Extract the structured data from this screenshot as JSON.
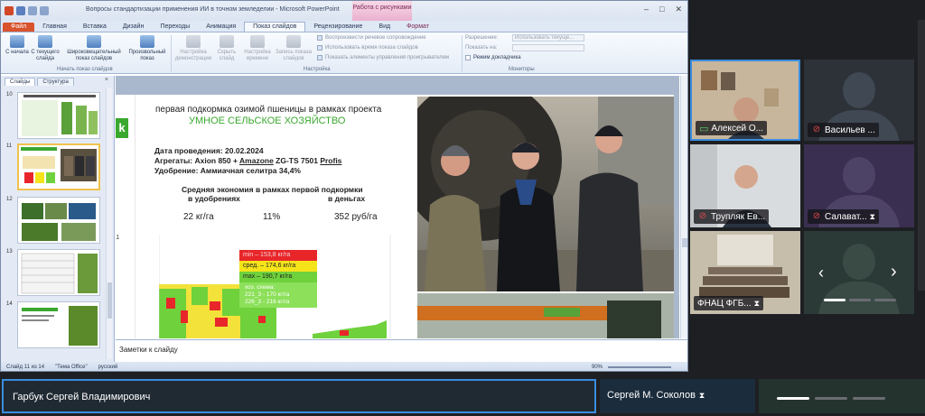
{
  "window": {
    "title": "Вопросы стандартизации применения ИИ в точном земледелии - Microsoft PowerPoint",
    "context_tool": "Работа с рисунками"
  },
  "tabs": [
    "Файл",
    "Главная",
    "Вставка",
    "Дизайн",
    "Переходы",
    "Анимация",
    "Показ слайдов",
    "Рецензирование",
    "Вид",
    "Формат"
  ],
  "ribbon": {
    "buttons": {
      "from_start": "С начала",
      "from_current": "С текущего слайда",
      "broadcast": "Широковещательный показ слайдов",
      "custom": "Произвольный показ",
      "setup": "Настройка демонстрации",
      "hide": "Скрыть слайд",
      "rehearse": "Настройка времени",
      "record": "Запись показа слайдов"
    },
    "groups": {
      "start": "Начать показ слайдов",
      "setup": "Настройка",
      "monitors": "Мониторы"
    },
    "checks": {
      "narration": "Воспроизвести речевое сопровождение",
      "timings": "Использовать время показа слайдов",
      "controls": "Показать элементы управления проигрывателем"
    },
    "monitors": {
      "resolution_label": "Разрешение:",
      "resolution_value": "Использовать текуще...",
      "show_on": "Показать на:",
      "presenter": "Режим докладчика"
    }
  },
  "pane": {
    "tabs": [
      "Слайды",
      "Структура"
    ],
    "close": "×",
    "slide_numbers": [
      "10",
      "11",
      "12",
      "13",
      "14"
    ]
  },
  "slide": {
    "heading1": "первая подкормка озимой пшеницы  в рамках проекта",
    "heading2": "УМНОЕ СЕЛЬСКОЕ ХОЗЯЙСТВО",
    "date": "Дата проведения: 20.02.2024",
    "machines_prefix": "Агрегаты: Axion 850 + ",
    "machines_brand": "Amazone",
    "machines_mid": " ZG-TS 7501 ",
    "machines_end": "Profis",
    "fertilizer": "Удобрение: Аммиачная селитра 34,4%",
    "economy_title": "Средняя экономия в рамках первой подкормки",
    "in_fert": "в удобрениях",
    "in_money": "в деньгах",
    "v_kg": "22 кг/га",
    "v_pct": "11%",
    "v_rub": "352 руб/га",
    "legend_min": "min – 153,8 кг/га",
    "legend_mid": "сред. – 174,6 кг/га",
    "legend_max": "max – 190,7 кг/га",
    "scheme_title": "хоз. схема:",
    "scheme_1": "221_3 - 170 кг/га",
    "scheme_2": "226_3 - 216 кг/га",
    "side_number": "11",
    "logo_fragment": "k"
  },
  "notes": "Заметки к слайду",
  "status": {
    "slide": "Слайд 11 из 14",
    "theme": "\"Тема Office\"",
    "lang": "русский",
    "zoom": "90%"
  },
  "participants": [
    {
      "name": "Алексей О...",
      "mic": "on"
    },
    {
      "name": "Васильев ...",
      "mic": "off"
    },
    {
      "name": "Трупляк Ев...",
      "mic": "off"
    },
    {
      "name": "Салават...",
      "mic": "off"
    },
    {
      "name": "ФНАЦ ФГБ...",
      "mic": "off"
    }
  ],
  "bottom": {
    "speaker": "Гарбук Сергей Владимирович",
    "second": "Сергей М. Соколов"
  },
  "colors": {
    "accent_green": "#3aa82f",
    "legend_red": "#e8262a",
    "legend_yellow": "#f5e41a",
    "legend_green": "#6fd13c",
    "tile_active_border": "#3a8dde"
  }
}
